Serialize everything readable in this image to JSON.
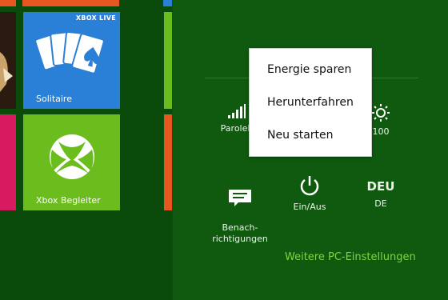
{
  "colors": {
    "start_background": "#0a4a0a",
    "charms_background": "#0f5a0f",
    "solitaire_tile": "#2a7fd6",
    "xbox_tile": "#6bbd1e",
    "red_tile": "#d81b60",
    "orange_tile": "#e6561e",
    "link_accent": "#7dd63f"
  },
  "tiles": {
    "solitaire": {
      "badge": "XBOX LIVE",
      "label": "Solitaire",
      "icon": "cards-icon"
    },
    "xbox_companion": {
      "label": "Xbox Begleiter",
      "icon": "xbox-logo-icon"
    }
  },
  "settings_panel": {
    "network": {
      "label": "ParoleE",
      "icon": "signal-bars-icon"
    },
    "brightness": {
      "label": "100",
      "icon": "sun-icon"
    },
    "notifications": {
      "label": "Benach-\nrichtigungen",
      "icon": "notification-icon"
    },
    "power": {
      "label": "Ein/Aus",
      "icon": "power-icon"
    },
    "keyboard": {
      "glyph": "DEU",
      "label": "DE"
    },
    "more_link": "Weitere PC-Einstellungen"
  },
  "power_menu": {
    "items": [
      "Energie sparen",
      "Herunterfahren",
      "Neu starten"
    ]
  }
}
